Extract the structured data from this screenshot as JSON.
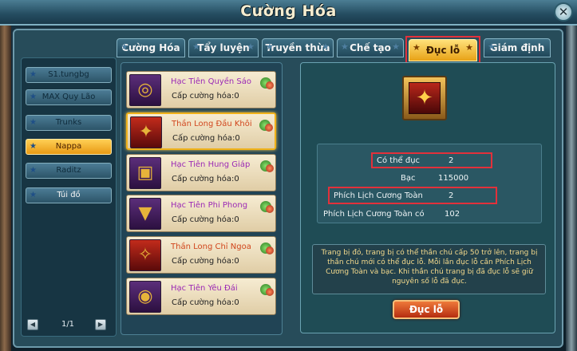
{
  "window": {
    "title": "Cường Hóa",
    "close_label": "✕"
  },
  "tabs": [
    {
      "label": "Cường Hóa",
      "active": false
    },
    {
      "label": "Tẩy luyện",
      "active": false
    },
    {
      "label": "Truyền thừa",
      "active": false
    },
    {
      "label": "Chế tạo",
      "active": false
    },
    {
      "label": "Đục lỗ",
      "active": true
    },
    {
      "label": "Giám định",
      "active": false
    }
  ],
  "tab_star_glyph": "★",
  "sidebar": {
    "items": [
      {
        "label": "S1.tungbg",
        "active": false
      },
      {
        "label": "MAX Quy Lão",
        "active": false
      },
      {
        "label": "Trunks",
        "active": false
      },
      {
        "label": "Nappa",
        "active": true
      },
      {
        "label": "Raditz",
        "active": false
      },
      {
        "label": "Túi đồ",
        "active": false
      }
    ],
    "pager": {
      "prev": "◀",
      "text": "1/1",
      "next": "▶"
    }
  },
  "equipment": [
    {
      "name": "Hạc Tiên Quyền Sáo",
      "level": "Cấp cường hóa:0",
      "icon": "ring-icon",
      "selected": false,
      "rarity": "purple"
    },
    {
      "name": "Thần Long Đầu Khôi",
      "level": "Cấp cường hóa:0",
      "icon": "helmet-icon",
      "selected": true,
      "rarity": "gold"
    },
    {
      "name": "Hạc Tiên Hung Giáp",
      "level": "Cấp cường hóa:0",
      "icon": "armor-icon",
      "selected": false,
      "rarity": "purple"
    },
    {
      "name": "Hạc Tiên Phi Phong",
      "level": "Cấp cường hóa:0",
      "icon": "cape-icon",
      "selected": false,
      "rarity": "purple"
    },
    {
      "name": "Thần Long Chỉ Ngoa",
      "level": "Cấp cường hóa:0",
      "icon": "boots-icon",
      "selected": false,
      "rarity": "gold"
    },
    {
      "name": "Hạc Tiên Yêu Đái",
      "level": "Cấp cường hóa:0",
      "icon": "belt-icon",
      "selected": false,
      "rarity": "purple"
    }
  ],
  "detail": {
    "stats": [
      {
        "label": "Có thể đục",
        "value": "2"
      },
      {
        "label": "Bạc",
        "value": "115000"
      },
      {
        "label": "Phích Lịch Cương Toàn",
        "value": "2"
      },
      {
        "label": "Phích Lịch Cương Toàn có",
        "value": "102"
      }
    ],
    "description": "Trang bị đỏ, trang bị có thể thần chú cấp 50 trở lên, trang bị thần chú mới có thể đục lỗ. Mỗi lần đục lỗ cần Phích Lịch Cương Toàn và bạc. Khi thần chú trang bị đã đục lỗ sẽ giữ nguyên số lỗ đã đục.",
    "action_label": "Đục lỗ"
  },
  "colors": {
    "highlight_border": "#e2313b",
    "active_tab": "#f5c241",
    "purple_item_name": "#9b2ab5",
    "gold_item_name": "#d1461d"
  }
}
